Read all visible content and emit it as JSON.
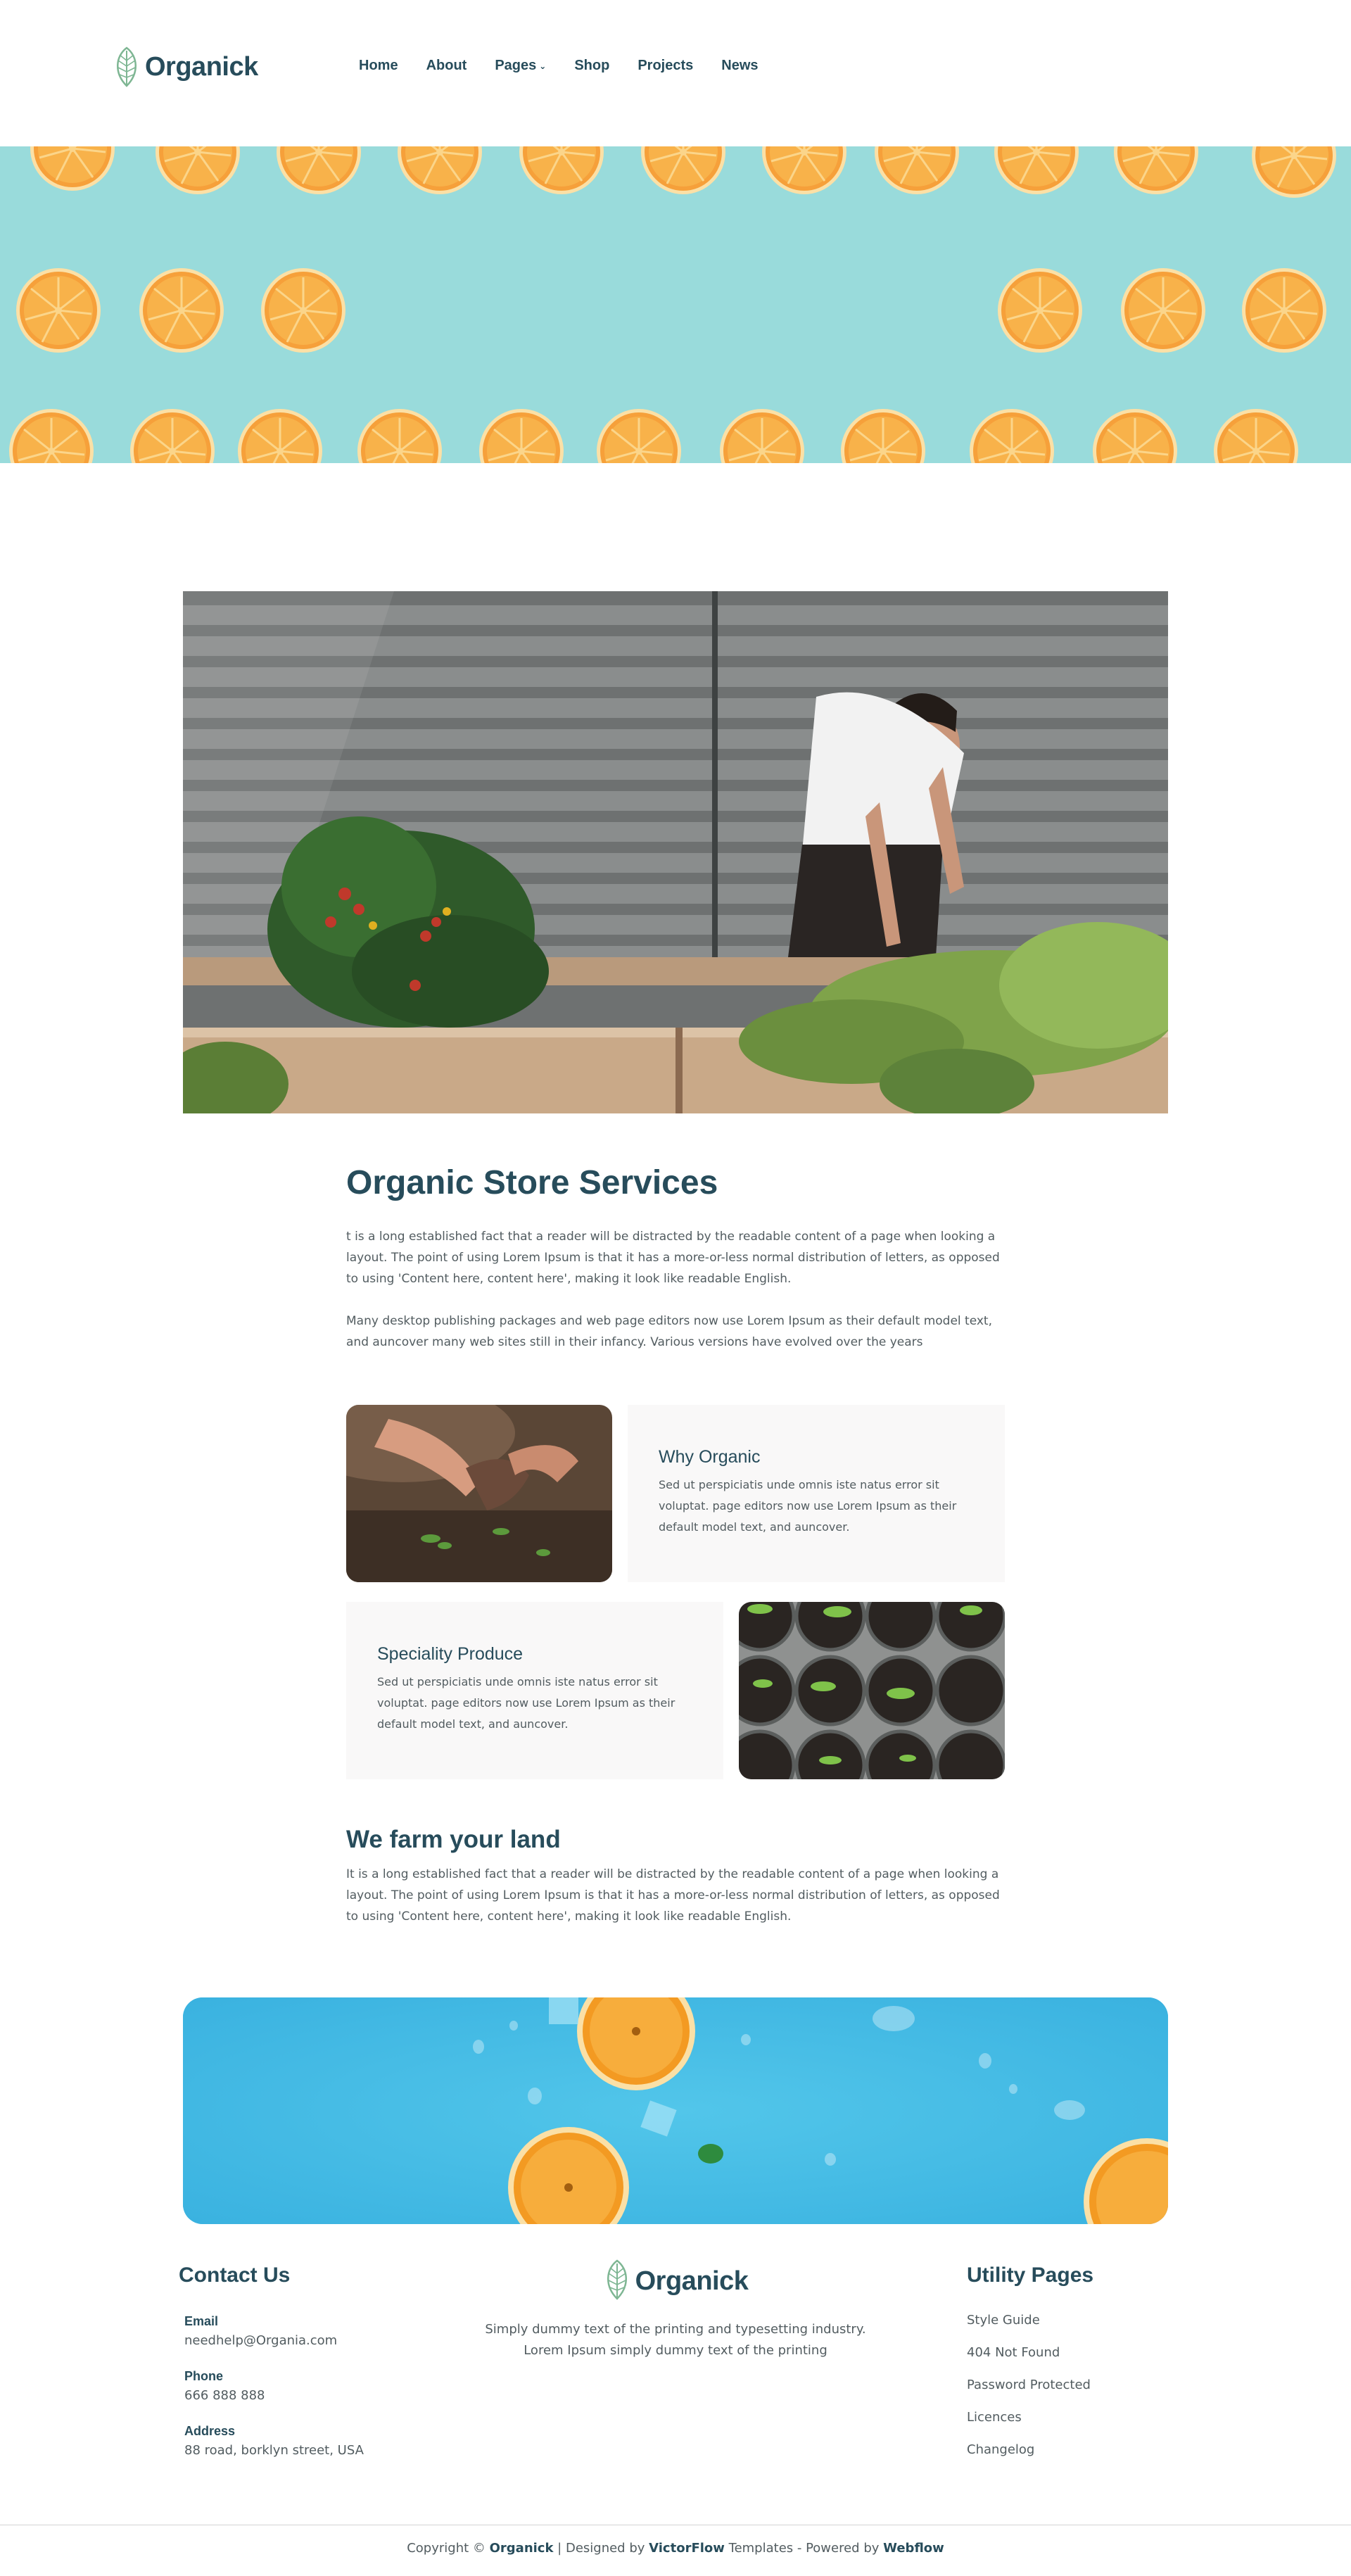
{
  "brand": {
    "name": "Organick"
  },
  "nav": {
    "items": [
      {
        "label": "Home"
      },
      {
        "label": "About"
      },
      {
        "label": "Pages",
        "has_dropdown": true
      },
      {
        "label": "Shop"
      },
      {
        "label": "Projects"
      },
      {
        "label": "News"
      }
    ]
  },
  "services": {
    "title": "Organic Store Services",
    "paragraph1": "t is a long established fact that a reader will be distracted by the readable content of a page when looking a layout. The point of using Lorem Ipsum is that it has a more-or-less normal distribution of letters, as opposed to using 'Content here, content here', making it look like readable English.",
    "paragraph2": "Many desktop publishing packages and web page editors now use Lorem Ipsum as their default model text, and auncover many web sites still in their infancy. Various versions have evolved over the years"
  },
  "features": [
    {
      "title": "Why Organic",
      "text": "Sed ut perspiciatis unde omnis iste natus error sit voluptat. page editors now use Lorem Ipsum as their default model text, and auncover."
    },
    {
      "title": "Speciality Produce",
      "text": "Sed ut perspiciatis unde omnis iste natus error sit voluptat. page editors now use Lorem Ipsum as their default model text, and auncover."
    }
  ],
  "farm": {
    "title": "We farm your land",
    "text": "It is a long established fact that a reader will be distracted by the readable content of a page when looking a layout. The point of using Lorem Ipsum is that it has a more-or-less normal distribution of letters, as opposed to using 'Content here, content here', making it look like readable English."
  },
  "footer": {
    "contact": {
      "title": "Contact Us",
      "email_label": "Email",
      "email": "needhelp@Organia.com",
      "phone_label": "Phone",
      "phone": "666 888 888",
      "address_label": "Address",
      "address": "88 road, borklyn street, USA"
    },
    "description_line1": "Simply dummy text of the printing and typesetting industry.",
    "description_line2": "Lorem Ipsum simply dummy text of the printing",
    "utility": {
      "title": "Utility Pages",
      "links": [
        "Style Guide",
        "404 Not Found",
        "Password Protected",
        "Licences",
        "Changelog"
      ]
    },
    "copyright": {
      "prefix": "Copyright © ",
      "brand": "Organick",
      "designed_by_text": " | Designed by ",
      "designer": "VictorFlow",
      "templates_text": " Templates - Powered by ",
      "platform": "Webflow"
    }
  },
  "colors": {
    "primary_text": "#274c5b",
    "body_text": "#525c60",
    "banner_teal": "#99dbdb",
    "banner_blue": "#45bce6",
    "card_bg": "#f9f8f8",
    "orange": "#f6a03a",
    "logo_green": "#7eb693"
  },
  "icons": [
    "leaf-logo-icon",
    "chevron-down-icon"
  ]
}
